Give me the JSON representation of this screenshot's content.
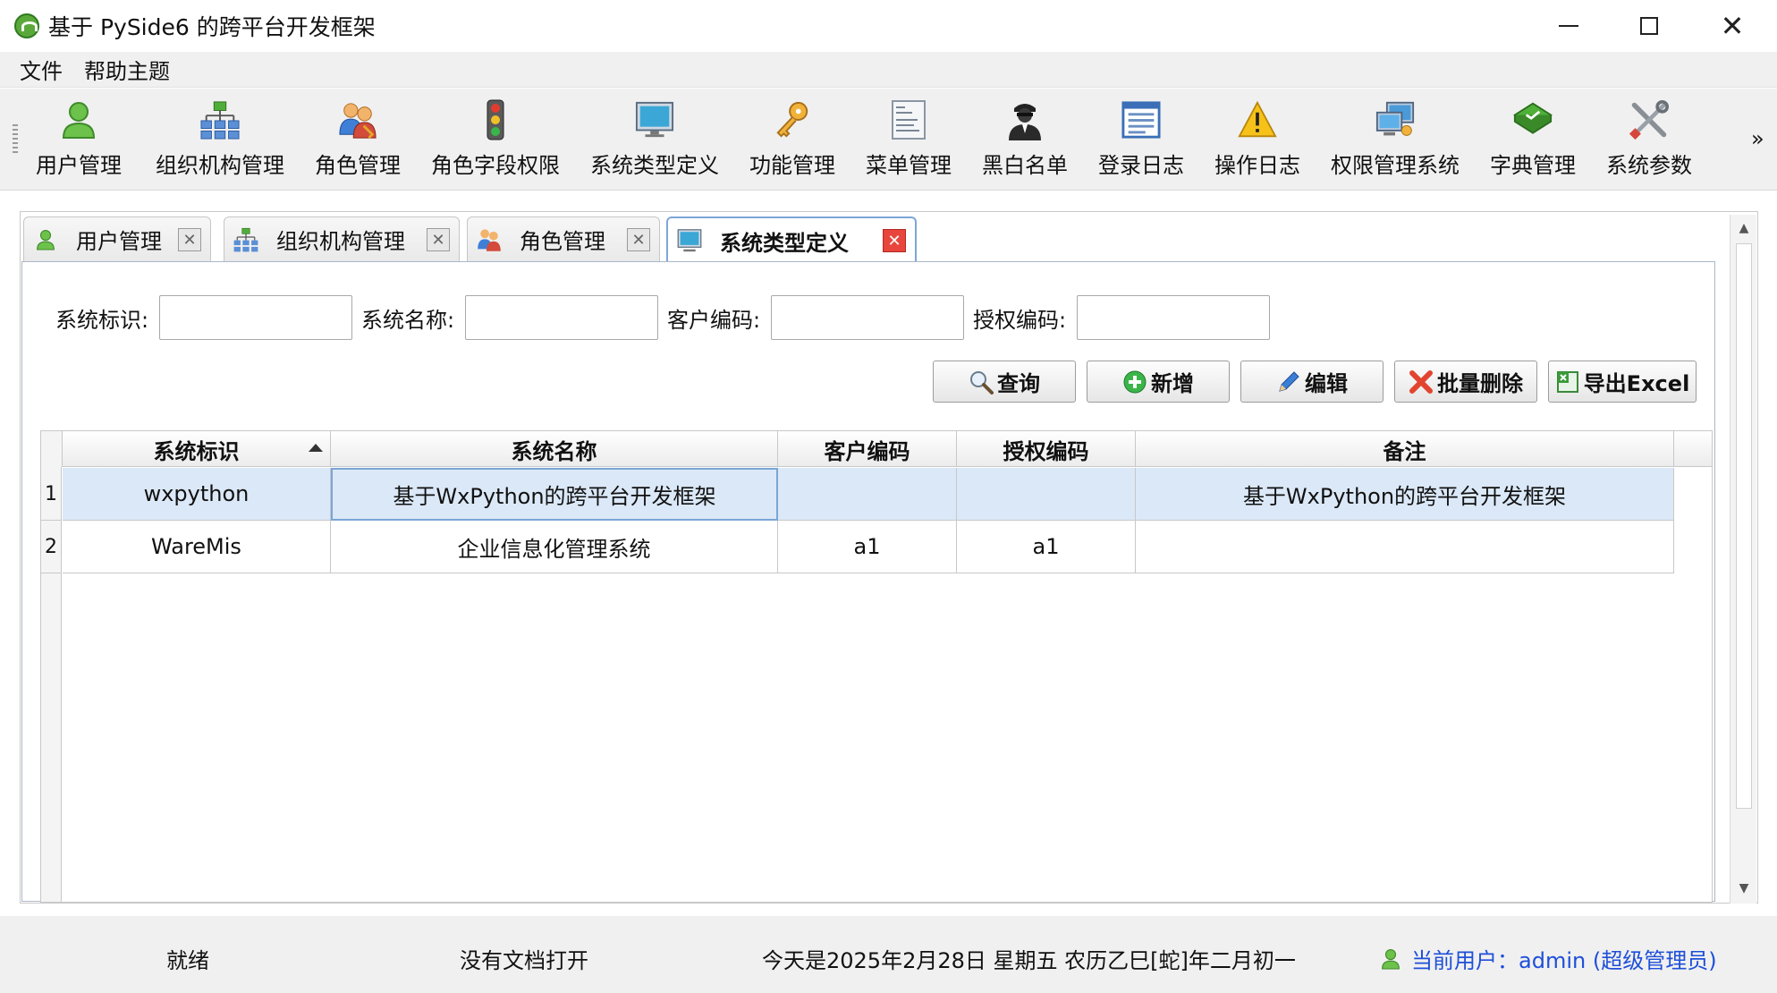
{
  "window": {
    "title": "基于 PySide6 的跨平台开发框架"
  },
  "menu": [
    "文件",
    "帮助主题"
  ],
  "toolbar": {
    "items": [
      {
        "label": "用户管理",
        "icon": "user-icon"
      },
      {
        "label": "组织机构管理",
        "icon": "org-chart-icon"
      },
      {
        "label": "角色管理",
        "icon": "roles-icon"
      },
      {
        "label": "角色字段权限",
        "icon": "traffic-light-icon"
      },
      {
        "label": "系统类型定义",
        "icon": "monitor-icon"
      },
      {
        "label": "功能管理",
        "icon": "keys-icon"
      },
      {
        "label": "菜单管理",
        "icon": "menu-doc-icon"
      },
      {
        "label": "黑白名单",
        "icon": "agent-icon"
      },
      {
        "label": "登录日志",
        "icon": "log-list-icon"
      },
      {
        "label": "操作日志",
        "icon": "warning-icon"
      },
      {
        "label": "权限管理系统",
        "icon": "computers-icon"
      },
      {
        "label": "字典管理",
        "icon": "book-icon"
      },
      {
        "label": "系统参数",
        "icon": "tools-icon"
      }
    ],
    "more": "»"
  },
  "tabs": [
    {
      "label": "用户管理",
      "active": false
    },
    {
      "label": "组织机构管理",
      "active": false
    },
    {
      "label": "角色管理",
      "active": false
    },
    {
      "label": "系统类型定义",
      "active": true
    }
  ],
  "form": {
    "fields": [
      {
        "label": "系统标识:",
        "value": ""
      },
      {
        "label": "系统名称:",
        "value": ""
      },
      {
        "label": "客户编码:",
        "value": ""
      },
      {
        "label": "授权编码:",
        "value": ""
      }
    ]
  },
  "actions": {
    "query": "查询",
    "add": "新增",
    "edit": "编辑",
    "batch_delete": "批量删除",
    "export": "导出Excel"
  },
  "grid": {
    "columns": [
      "系统标识",
      "系统名称",
      "客户编码",
      "授权编码",
      "备注"
    ],
    "sorted_column": 0,
    "rows": [
      {
        "num": "1",
        "cells": [
          "wxpython",
          "基于WxPython的跨平台开发框架",
          "",
          "",
          "基于WxPython的跨平台开发框架"
        ],
        "selected": true
      },
      {
        "num": "2",
        "cells": [
          "WareMis",
          "企业信息化管理系统",
          "a1",
          "a1",
          ""
        ],
        "selected": false
      }
    ]
  },
  "status": {
    "ready": "就绪",
    "no_doc": "没有文档打开",
    "date": "今天是2025年2月28日 星期五 农历乙巳[蛇]年二月初一",
    "user": "当前用户：admin (超级管理员)"
  },
  "colors": {
    "accent_blue": "#1e4fd8",
    "close_red": "#e8453c",
    "selected_row": "#dbe8f7"
  }
}
